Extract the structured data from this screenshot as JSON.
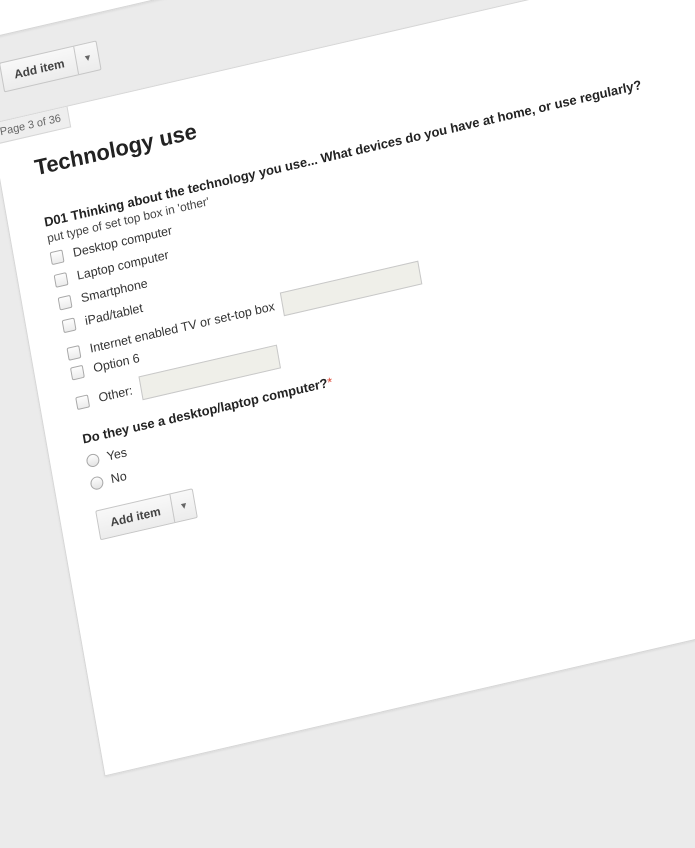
{
  "add_item": {
    "label": "Add item"
  },
  "page": {
    "indicator": "Page 3 of 36",
    "title": "Technology use"
  },
  "q1": {
    "title": "D01 Thinking about the technology you use... What devices do you have at home, or use regularly?",
    "help": "put type of set top box in 'other'",
    "options": [
      "Desktop computer",
      "Laptop computer",
      "Smartphone",
      "iPad/tablet",
      "Internet enabled TV or set-top box",
      "Option 6",
      "Other:"
    ],
    "required_mark": "*"
  },
  "q2": {
    "title": "Do they use a desktop/laptop computer?",
    "options": [
      "Yes",
      "No"
    ]
  }
}
